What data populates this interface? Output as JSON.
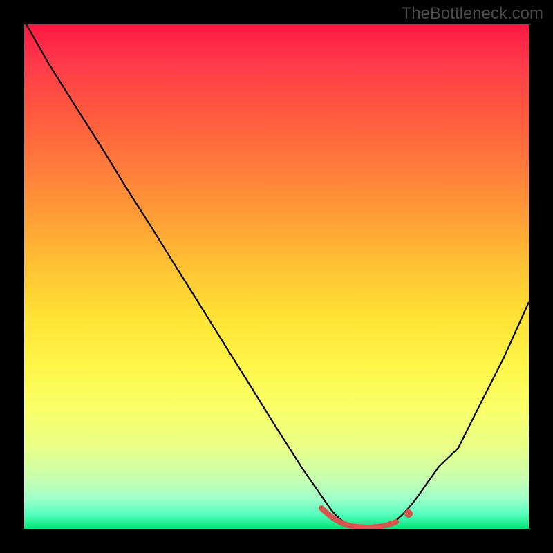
{
  "watermark": "TheBottleneck.com",
  "chart_data": {
    "type": "line",
    "title": "",
    "xlabel": "",
    "ylabel": "",
    "xlim": [
      0,
      100
    ],
    "ylim": [
      0,
      100
    ],
    "grid": false,
    "background_gradient": {
      "top_color": "#ff1744",
      "bottom_color": "#00e676",
      "description": "vertical gradient red (top, high bottleneck) to green (bottom, optimal)"
    },
    "series": [
      {
        "name": "bottleneck-curve",
        "x": [
          0,
          5,
          10,
          15,
          20,
          25,
          30,
          35,
          40,
          45,
          50,
          55,
          60,
          62,
          65,
          68,
          70,
          72,
          75,
          78,
          82,
          86,
          90,
          95,
          100
        ],
        "values": [
          100,
          92,
          84,
          76,
          68,
          60,
          52,
          44,
          36,
          28,
          20,
          12,
          5,
          2,
          0.5,
          0,
          0,
          0.5,
          1.5,
          4,
          9,
          16,
          24,
          34,
          45
        ]
      }
    ],
    "optimal_range": {
      "x_start": 58,
      "x_end": 76,
      "description": "flat-bottom of the curve marked as the optimal match range"
    },
    "annotations": []
  }
}
